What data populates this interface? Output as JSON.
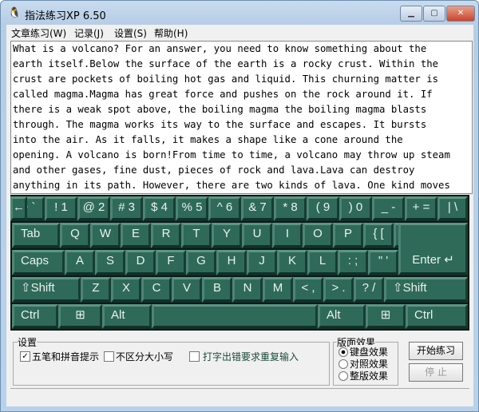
{
  "window": {
    "title": "指法练习XP 6.50",
    "controls": [
      "minimize",
      "maximize",
      "close"
    ]
  },
  "menu": [
    "文章练习(W)",
    "记录(J)",
    "设置(S)",
    "帮助(H)"
  ],
  "text_lines": [
    "What is a volcano? For an answer, you need to know something about the",
    "earth itself.Below the surface of the earth is a rocky crust. Within the",
    "crust are pockets of boiling hot gas and liquid. This churning matter is",
    "called magma.Magma has great force and pushes on the rock around it. If",
    "there is a weak spot above, the boiling magma the boiling magma blasts",
    "through. The magma works its way to the surface and escapes. It bursts",
    "into the air. As it falls, it makes a shape like a cone around the",
    "opening. A volcano is born!From time to time, a volcano may throw up steam",
    "and other gases, fine dust, pieces of rock and lava.Lava can destroy",
    "anything in its path. However, there are two kinds of lava. One kind moves"
  ],
  "keyboard": {
    "row1": [
      "~ `",
      "! 1",
      "@ 2",
      "# 3",
      "$ 4",
      "% 5",
      "^ 6",
      "& 7",
      "* 8",
      "( 9",
      ") 0",
      "_ -",
      "+ =",
      "| \\",
      "←"
    ],
    "row2": [
      "Tab",
      "Q",
      "W",
      "E",
      "R",
      "T",
      "Y",
      "U",
      "I",
      "O",
      "P",
      "{ [",
      "} ]"
    ],
    "row3": [
      "Caps",
      "A",
      "S",
      "D",
      "F",
      "G",
      "H",
      "J",
      "K",
      "L",
      ": ;",
      "\" '",
      "Enter ↵"
    ],
    "row4": [
      "⇧Shift",
      "Z",
      "X",
      "C",
      "V",
      "B",
      "N",
      "M",
      "< ,",
      "> .",
      "? /",
      "⇧Shift"
    ],
    "row5": [
      "Ctrl",
      "⊞",
      "Alt",
      "",
      "Alt",
      "⊞",
      "Ctrl"
    ]
  },
  "settings": {
    "title": "设置",
    "options": [
      {
        "label": "五笔和拼音提示",
        "checked": true
      },
      {
        "label": "不区分大小写",
        "checked": false
      },
      {
        "label": "打字出错要求重复输入",
        "checked": false
      }
    ]
  },
  "layout_effect": {
    "title": "版面效果",
    "options": [
      "键盘效果",
      "对照效果",
      "整版效果"
    ],
    "selected": 0
  },
  "buttons": {
    "start": "开始练习",
    "stop": "停 止"
  },
  "colors": {
    "key": "#2f6a58",
    "keyboard_bg": "#0c1a14",
    "option_text": "#1a4a3a"
  }
}
